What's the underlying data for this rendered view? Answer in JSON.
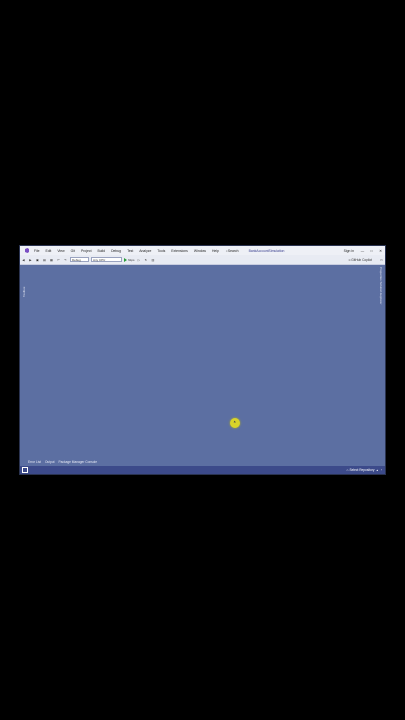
{
  "window": {
    "menus": [
      "File",
      "Edit",
      "View",
      "Git",
      "Project",
      "Build",
      "Debug",
      "Test",
      "Analyze",
      "Tools",
      "Extensions",
      "Window",
      "Help"
    ],
    "search_label": "Search",
    "solution_name": "BankAccountSimulation",
    "signin_label": "Sign in",
    "min_symbol": "—",
    "max_symbol": "□",
    "close_symbol": "✕"
  },
  "toolbar": {
    "config": "Debug",
    "platform": "Any CPU",
    "run_target": "https",
    "copilot": "GitHub Copilot"
  },
  "side": {
    "left_tab": "Toolbox",
    "right_tabs": "Properties   Solution Explorer"
  },
  "bottom_tabs": [
    "Error List",
    "Output",
    "Package Manager Console"
  ],
  "status": {
    "repo": "Select Repository"
  },
  "colors": {
    "editor_bg": "#5c6fa2",
    "statusbar": "#3c4a8a",
    "cursor": "#d8d32a"
  }
}
